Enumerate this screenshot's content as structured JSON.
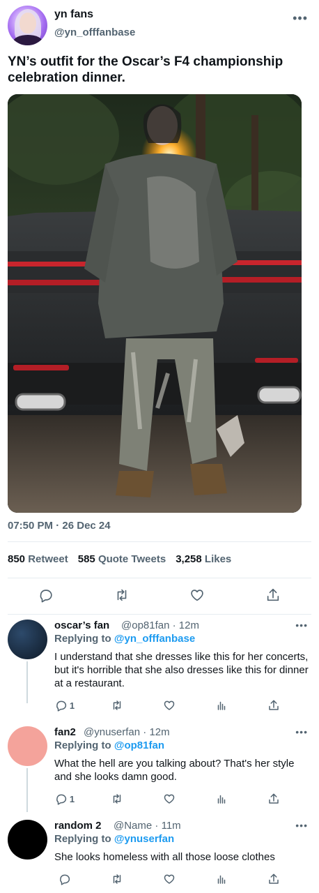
{
  "tweet": {
    "display_name": "yn fans",
    "handle": "@yn_offfanbase",
    "more": "•••",
    "text": "YN’s outfit for the Oscar’s F4 championship celebration dinner.",
    "time": "07:50 PM",
    "separator": "·",
    "date": "26 Dec 24",
    "stats": {
      "retweets": "850",
      "retweets_label": "Retweet",
      "quotes": "585",
      "quotes_label": "Quote Tweets",
      "likes": "3,258",
      "likes_label": "Likes"
    }
  },
  "replies": [
    {
      "name": "oscar’s fan",
      "handle": "@op81fan",
      "time": "· 12m",
      "replying_prefix": "Replying to",
      "replying_to": "@yn_offfanbase",
      "text": "I understand that she dresses like this for her concerts, but it's horrible that she also dresses like this for dinner at a restaurant.",
      "reply_count": "1",
      "avatar_color": "#1c2f45"
    },
    {
      "name": "fan2",
      "handle": "@ynuserfan",
      "time": "· 12m",
      "replying_prefix": "Replying to",
      "replying_to": "@op81fan",
      "text": "What the hell are you talking about? That's her style and she looks damn good.",
      "reply_count": "1",
      "avatar_color": "#f4a39b"
    },
    {
      "name": "random 2",
      "handle": "@Name",
      "time": "· 11m",
      "replying_prefix": "Replying to",
      "replying_to": "@ynuserfan",
      "text": "She looks homeless with all those loose clothes",
      "reply_count": "",
      "avatar_color": "#000000"
    }
  ],
  "icons": {
    "reply": "reply-icon",
    "retweet": "retweet-icon",
    "like": "heart-icon",
    "views": "analytics-icon",
    "share": "share-icon"
  },
  "colors": {
    "accent": "#1d9bf0",
    "muted": "#536471",
    "text": "#0f1419"
  }
}
